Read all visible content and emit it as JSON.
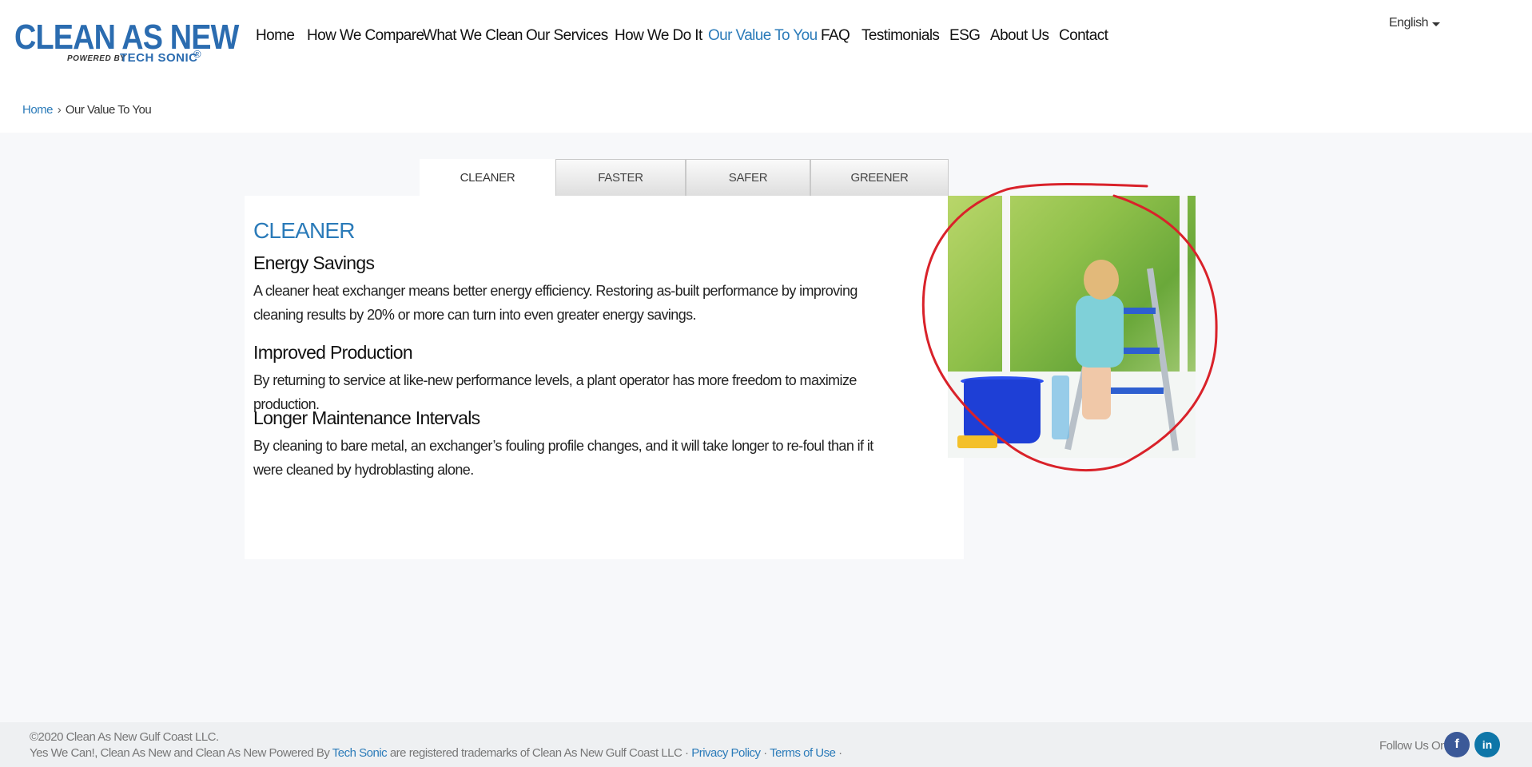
{
  "brand": {
    "logo_main": "CLEAN AS NEW",
    "logo_powered": "POWERED BY",
    "logo_brand": "TECH SONIC",
    "logo_reg": "®",
    "brand_color": "#2b6cb0"
  },
  "nav": {
    "items": [
      {
        "label": "Home"
      },
      {
        "label": "How We Compare"
      },
      {
        "label": "What We Clean"
      },
      {
        "label": "Our Services"
      },
      {
        "label": "How We Do It"
      },
      {
        "label": "Our Value To You",
        "active": true
      },
      {
        "label": "FAQ"
      },
      {
        "label": "Testimonials"
      },
      {
        "label": "ESG"
      },
      {
        "label": "About Us"
      },
      {
        "label": "Contact"
      }
    ],
    "active_color": "#2b7bb9"
  },
  "language": {
    "selected": "English"
  },
  "breadcrumb": {
    "home": "Home",
    "separator": "›",
    "current": "Our Value To You"
  },
  "tabs": [
    {
      "label": "CLEANER",
      "active": true
    },
    {
      "label": "FASTER"
    },
    {
      "label": "SAFER"
    },
    {
      "label": "GREENER"
    }
  ],
  "content": {
    "heading": "CLEANER",
    "sections": [
      {
        "title": "Energy Savings",
        "body": "A cleaner heat exchanger means better energy efficiency. Restoring as-built performance by improving cleaning results by 20% or more can turn into even greater energy savings."
      },
      {
        "title": "Improved Production",
        "body": "By returning to service at like-new performance levels, a plant operator has more freedom to maximize production."
      },
      {
        "title": "Longer Maintenance Intervals",
        "body": "By cleaning to bare metal, an exchanger’s fouling profile changes, and it will take longer to re-foul than if it were cleaned by hydroblasting alone."
      }
    ]
  },
  "annotation": {
    "color": "#d9222a"
  },
  "footer": {
    "copyright": "©2020 Clean As New Gulf Coast LLC.",
    "trademark_prefix": "Yes We Can!, Clean As New and Clean As New Powered By",
    "tech_sonic": "Tech Sonic",
    "trademark_suffix": "are registered trademarks of Clean As New Gulf Coast LLC ·",
    "privacy": "Privacy Policy",
    "dot": "·",
    "terms": "Terms of Use",
    "dot2": "·",
    "follow": "Follow Us On:",
    "facebook_icon": "f",
    "linkedin_icon": "in"
  }
}
